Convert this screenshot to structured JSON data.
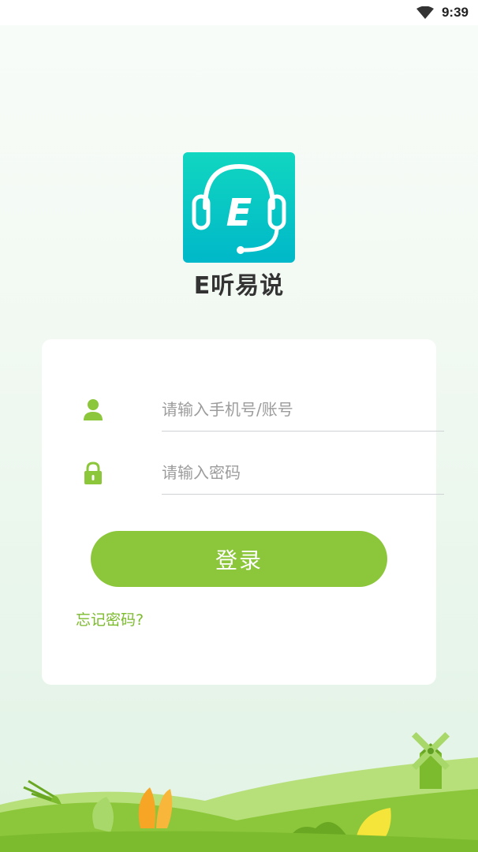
{
  "status_bar": {
    "time": "9:39"
  },
  "app": {
    "name": "E听易说",
    "logo_letter": "E"
  },
  "login_form": {
    "account_placeholder": "请输入手机号/账号",
    "password_placeholder": "请输入密码",
    "login_button": "登录",
    "forgot_password": "忘记密码?"
  },
  "colors": {
    "accent_green": "#8cc63a",
    "link_green": "#7cbb2e",
    "logo_teal": "#00c2c4"
  },
  "icons": {
    "status": [
      "wifi-icon"
    ],
    "fields": [
      "user-icon",
      "lock-icon"
    ]
  }
}
